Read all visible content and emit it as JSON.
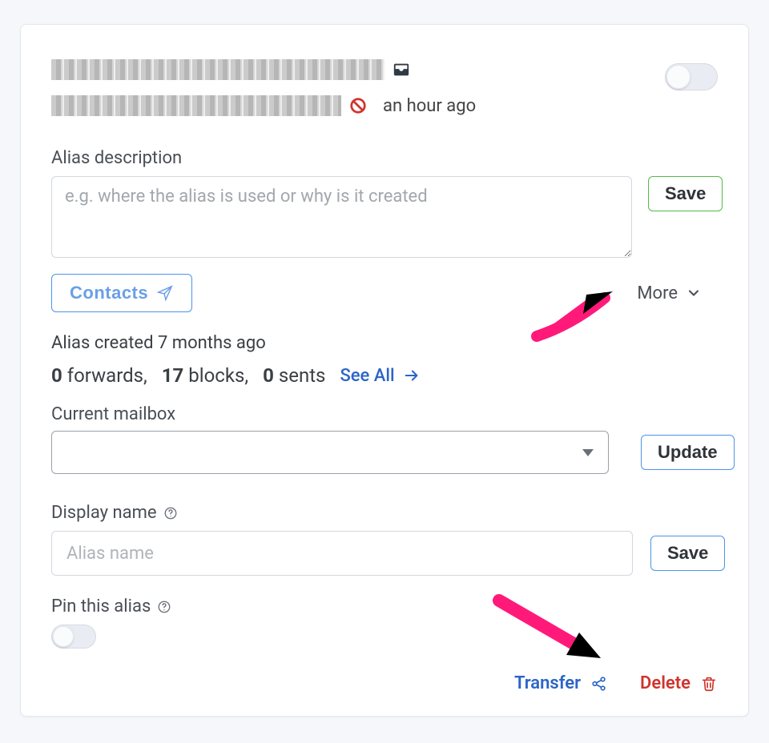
{
  "header": {
    "last_activity": "an hour ago",
    "toggle_on": false
  },
  "description": {
    "label": "Alias description",
    "placeholder": "e.g. where the alias is used or why is it created",
    "value": "",
    "save_label": "Save"
  },
  "contacts_label": "Contacts",
  "more_label": "More",
  "created_line": "Alias created 7 months ago",
  "stats": {
    "forwards": 0,
    "forwards_label": "forwards,",
    "blocks": 17,
    "blocks_label": "blocks,",
    "sents": 0,
    "sents_label": "sents",
    "see_all": "See All"
  },
  "mailbox": {
    "label": "Current mailbox",
    "update_label": "Update"
  },
  "display_name": {
    "label": "Display name",
    "placeholder": "Alias name",
    "value": "",
    "save_label": "Save"
  },
  "pin": {
    "label": "Pin this alias",
    "on": false
  },
  "footer": {
    "transfer": "Transfer",
    "delete": "Delete"
  }
}
